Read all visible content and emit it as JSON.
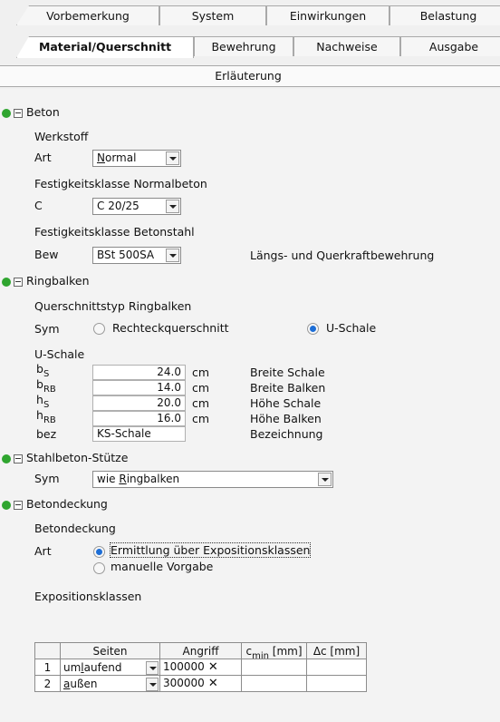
{
  "tabs": {
    "row1": [
      "Vorbemerkung",
      "System",
      "Einwirkungen",
      "Belastung"
    ],
    "row2": [
      "Material/Querschnitt",
      "Bewehrung",
      "Nachweise",
      "Ausgabe"
    ],
    "row3": [
      "Erläuterung"
    ],
    "active": "Material/Querschnitt"
  },
  "beton": {
    "title": "Beton",
    "werkstoff_label": "Werkstoff",
    "art_label": "Art",
    "art_value_first": "N",
    "art_value_rest": "ormal",
    "festigkeit_label": "Festigkeitsklasse Normalbeton",
    "c_label": "C",
    "c_value": "C 20/25",
    "stahl_label": "Festigkeitsklasse Betonstahl",
    "bew_label": "Bew",
    "bew_value": "BSt 500SA",
    "bew_desc": "Längs- und Querkraftbewehrung"
  },
  "ringbalken": {
    "title": "Ringbalken",
    "qtyp_label": "Querschnittstyp Ringbalken",
    "sym_label": "Sym",
    "option1": "Rechteckquerschnitt",
    "option2": "U-Schale",
    "selected": "U-Schale",
    "uschale_label": "U-Schale",
    "params": [
      {
        "sym": "b",
        "sub": "S",
        "value": "24.0",
        "unit": "cm",
        "desc": "Breite Schale"
      },
      {
        "sym": "b",
        "sub": "RB",
        "value": "14.0",
        "unit": "cm",
        "desc": "Breite Balken"
      },
      {
        "sym": "h",
        "sub": "S",
        "value": "20.0",
        "unit": "cm",
        "desc": "Höhe Schale"
      },
      {
        "sym": "h",
        "sub": "RB",
        "value": "16.0",
        "unit": "cm",
        "desc": "Höhe Balken"
      }
    ],
    "bez_label": "bez",
    "bez_value": "KS-Schale",
    "bez_desc": "Bezeichnung"
  },
  "stuetze": {
    "title": "Stahlbeton-Stütze",
    "sym_label": "Sym",
    "value_pre": "wie ",
    "value_u": "R",
    "value_rest": "ingbalken"
  },
  "betondeckung": {
    "title": "Betondeckung",
    "sub_label": "Betondeckung",
    "art_label": "Art",
    "option1": "Ermittlung über Expositionsklassen",
    "option2": "manuelle Vorgabe",
    "selected": "Ermittlung über Expositionsklassen"
  },
  "expo": {
    "label": "Expositionsklassen",
    "headers": {
      "seiten": "Seiten",
      "angriff": "Angriff",
      "cmin": "c",
      "cmin_sub": "min",
      "cmin_unit": " [mm]",
      "dc": "Δc [mm]"
    },
    "rows": [
      {
        "nr": "1",
        "seiten_pre": "um",
        "seiten_u": "l",
        "seiten_rest": "aufend",
        "angriff": "100000",
        "cmin": "",
        "dc": ""
      },
      {
        "nr": "2",
        "seiten_pre": "",
        "seiten_u": "a",
        "seiten_rest": "ußen",
        "angriff": "300000",
        "cmin": "",
        "dc": ""
      }
    ]
  },
  "colors": {
    "status_dot": "#2fa52f",
    "radio_selected": "#1d6ed6"
  }
}
